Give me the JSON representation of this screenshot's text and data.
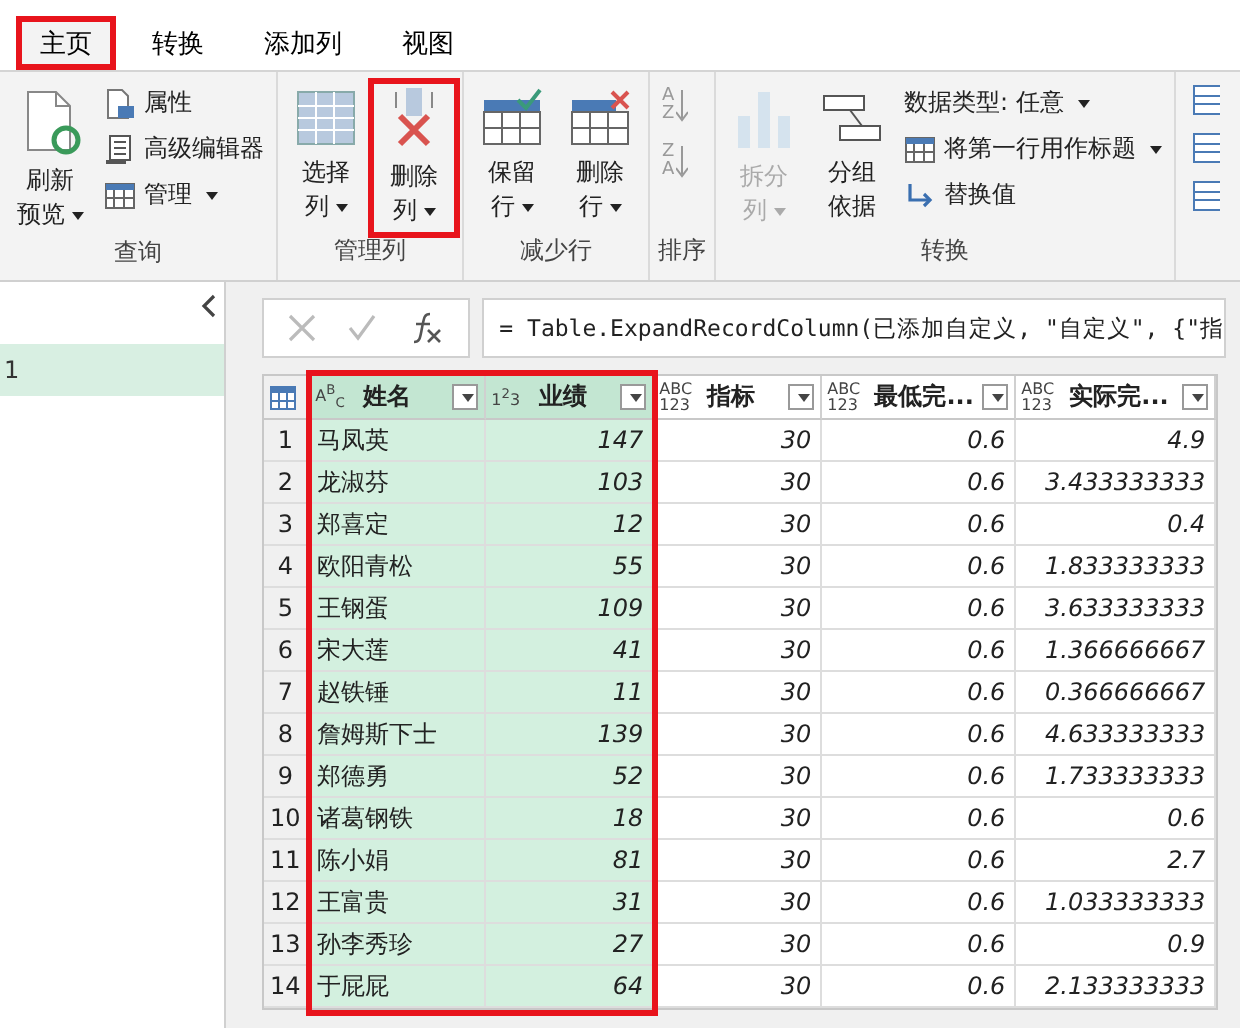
{
  "tabs": [
    {
      "label": "主页",
      "selected": true,
      "highlighted": true
    },
    {
      "label": "转换",
      "selected": false,
      "highlighted": false
    },
    {
      "label": "添加列",
      "selected": false,
      "highlighted": false
    },
    {
      "label": "视图",
      "selected": false,
      "highlighted": false
    }
  ],
  "ribbon": {
    "groups": [
      {
        "label": "查询",
        "items": [
          {
            "kind": "large",
            "lines": [
              "刷新",
              "预览"
            ],
            "dropdown": true,
            "disabled": false,
            "highlighted": false
          },
          {
            "kind": "stack",
            "entries": [
              {
                "label": "属性",
                "dropdown": false
              },
              {
                "label": "高级编辑器",
                "dropdown": false
              },
              {
                "label": "管理",
                "dropdown": true
              }
            ]
          }
        ]
      },
      {
        "label": "管理列",
        "items": [
          {
            "kind": "large",
            "lines": [
              "选择",
              "列"
            ],
            "dropdown": true,
            "disabled": false,
            "highlighted": false
          },
          {
            "kind": "large",
            "lines": [
              "删除",
              "列"
            ],
            "dropdown": true,
            "disabled": false,
            "highlighted": true
          }
        ]
      },
      {
        "label": "减少行",
        "items": [
          {
            "kind": "large",
            "lines": [
              "保留",
              "行"
            ],
            "dropdown": true,
            "disabled": false,
            "highlighted": false
          },
          {
            "kind": "large",
            "lines": [
              "删除",
              "行"
            ],
            "dropdown": true,
            "disabled": false,
            "highlighted": false
          }
        ]
      },
      {
        "label": "排序",
        "items": [
          {
            "kind": "sort",
            "buttons": [
              {
                "glyph": "AZ"
              },
              {
                "glyph": "ZA"
              }
            ]
          }
        ]
      },
      {
        "label": "转换",
        "items": [
          {
            "kind": "large",
            "lines": [
              "拆分",
              "列"
            ],
            "dropdown": true,
            "disabled": true,
            "highlighted": false
          },
          {
            "kind": "large",
            "lines": [
              "分组",
              "依据"
            ],
            "dropdown": false,
            "disabled": false,
            "highlighted": false
          },
          {
            "kind": "stack",
            "entries": [
              {
                "label": "数据类型: 任意",
                "dropdown": true
              },
              {
                "label": "将第一行用作标题",
                "dropdown": true
              },
              {
                "label": "替换值",
                "dropdown": false
              }
            ]
          }
        ]
      }
    ]
  },
  "queries_pane": {
    "items": [
      {
        "label": "1",
        "selected": true
      }
    ]
  },
  "formula_bar": {
    "formula": "= Table.ExpandRecordColumn(已添加自定义, \"自定义\", {\"指"
  },
  "table": {
    "columns": [
      {
        "type_label": "A$^{B}$$_{C}$",
        "name": "姓名",
        "selected": true,
        "highlighted": true
      },
      {
        "type_label": "1$^{2}$3",
        "name": "业绩",
        "selected": true,
        "highlighted": true
      },
      {
        "type_label": "ABC 123",
        "name": "指标",
        "selected": false,
        "highlighted": false
      },
      {
        "type_label": "ABC 123",
        "name": "最低完...",
        "selected": false,
        "highlighted": false
      },
      {
        "type_label": "ABC 123",
        "name": "实际完...",
        "selected": false,
        "highlighted": false
      }
    ],
    "rows": [
      {
        "row_number": "1",
        "cells": [
          "马凤英",
          "147",
          "30",
          "0.6",
          "4.9"
        ]
      },
      {
        "row_number": "2",
        "cells": [
          "龙淑芬",
          "103",
          "30",
          "0.6",
          "3.433333333"
        ]
      },
      {
        "row_number": "3",
        "cells": [
          "郑喜定",
          "12",
          "30",
          "0.6",
          "0.4"
        ]
      },
      {
        "row_number": "4",
        "cells": [
          "欧阳青松",
          "55",
          "30",
          "0.6",
          "1.833333333"
        ]
      },
      {
        "row_number": "5",
        "cells": [
          "王钢蛋",
          "109",
          "30",
          "0.6",
          "3.633333333"
        ]
      },
      {
        "row_number": "6",
        "cells": [
          "宋大莲",
          "41",
          "30",
          "0.6",
          "1.366666667"
        ]
      },
      {
        "row_number": "7",
        "cells": [
          "赵铁锤",
          "11",
          "30",
          "0.6",
          "0.366666667"
        ]
      },
      {
        "row_number": "8",
        "cells": [
          "詹姆斯下士",
          "139",
          "30",
          "0.6",
          "4.633333333"
        ]
      },
      {
        "row_number": "9",
        "cells": [
          "郑德勇",
          "52",
          "30",
          "0.6",
          "1.733333333"
        ]
      },
      {
        "row_number": "10",
        "cells": [
          "诸葛钢铁",
          "18",
          "30",
          "0.6",
          "0.6"
        ]
      },
      {
        "row_number": "11",
        "cells": [
          "陈小娟",
          "81",
          "30",
          "0.6",
          "2.7"
        ]
      },
      {
        "row_number": "12",
        "cells": [
          "王富贵",
          "31",
          "30",
          "0.6",
          "1.033333333"
        ]
      },
      {
        "row_number": "13",
        "cells": [
          "孙李秀珍",
          "27",
          "30",
          "0.6",
          "0.9"
        ]
      },
      {
        "row_number": "14",
        "cells": [
          "于屁屁",
          "64",
          "30",
          "0.6",
          "2.133333333"
        ]
      }
    ]
  }
}
